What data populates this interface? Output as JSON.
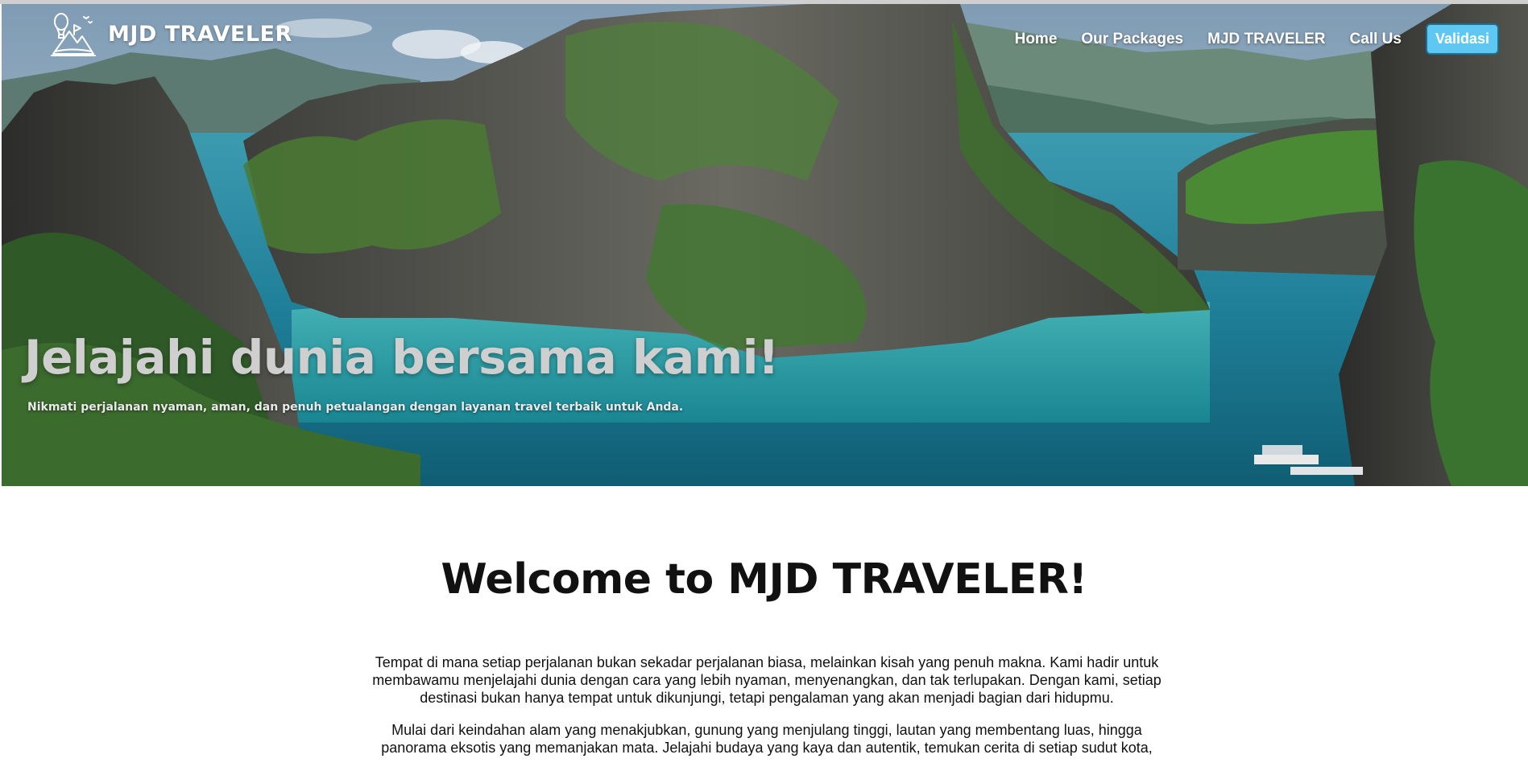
{
  "brand": {
    "name": "MJD TRAVELER"
  },
  "nav": {
    "items": [
      "Home",
      "Our Packages",
      "MJD TRAVELER",
      "Call Us"
    ],
    "cta": "Validasi"
  },
  "hero": {
    "title": "Jelajahi dunia bersama kami!",
    "subtitle": "Nikmati perjalanan nyaman, aman, dan penuh petualangan dengan layanan travel terbaik untuk Anda."
  },
  "welcome": {
    "heading": "Welcome to MJD TRAVELER!",
    "paragraphs": [
      "Tempat di mana setiap perjalanan bukan sekadar perjalanan biasa, melainkan kisah yang penuh makna. Kami hadir untuk membawamu menjelajahi dunia dengan cara yang lebih nyaman, menyenangkan, dan tak terlupakan. Dengan kami, setiap destinasi bukan hanya tempat untuk dikunjungi, tetapi pengalaman yang akan menjadi bagian dari hidupmu.",
      "Mulai dari keindahan alam yang menakjubkan, gunung yang menjulang tinggi, lautan yang membentang luas, hingga panorama eksotis yang memanjakan mata. Jelajahi budaya yang kaya dan autentik, temukan cerita di setiap sudut kota,"
    ]
  },
  "colors": {
    "accent": "#5ec8f2",
    "accent_border": "#1f6f95",
    "hero_title": "#cfcfcf",
    "text": "#111111"
  },
  "icons": {
    "logo": "hot-air-balloon-mountain-logo"
  }
}
